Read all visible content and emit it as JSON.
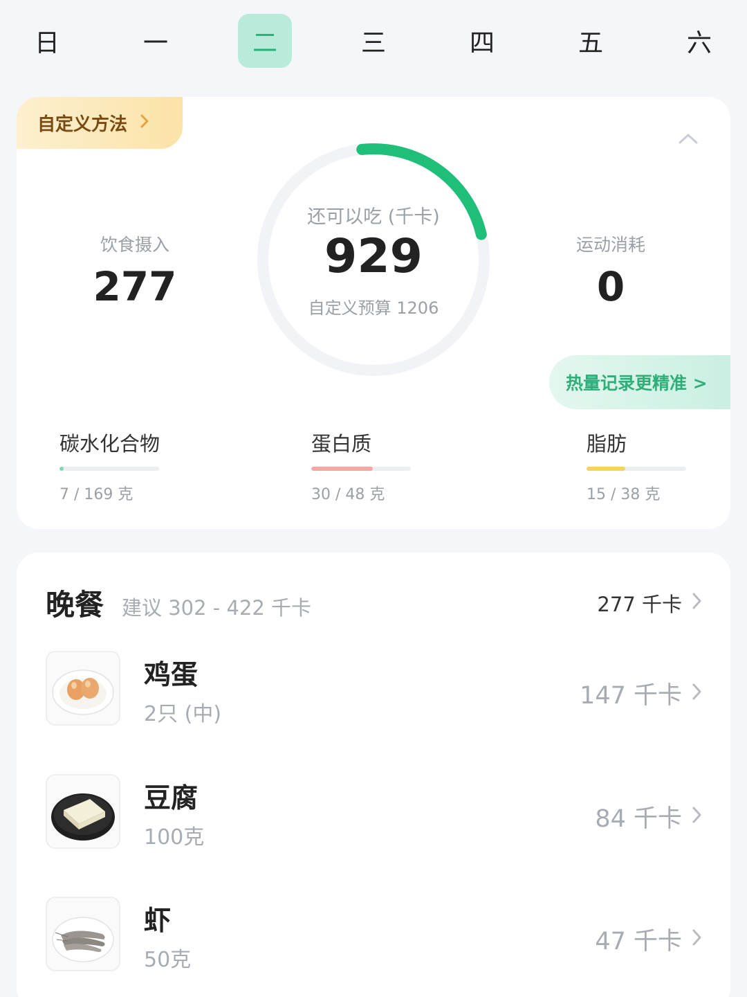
{
  "weekdays": [
    {
      "label": "日",
      "active": false
    },
    {
      "label": "一",
      "active": false
    },
    {
      "label": "二",
      "active": true
    },
    {
      "label": "三",
      "active": false
    },
    {
      "label": "四",
      "active": false
    },
    {
      "label": "五",
      "active": false
    },
    {
      "label": "六",
      "active": false
    }
  ],
  "summary": {
    "custom_method_label": "自定义方法",
    "intake_label": "饮食摄入",
    "intake_value": "277",
    "remaining_label": "还可以吃 (千卡)",
    "remaining_value": "929",
    "budget_label": "自定义预算 1206",
    "remaining_fraction": 0.23,
    "exercise_label": "运动消耗",
    "exercise_value": "0",
    "precise_label": "热量记录更精准 >",
    "accent_color": "#1fbf7a"
  },
  "macros": [
    {
      "name": "碳水化合物",
      "amount": "7 / 169 克",
      "fraction": 0.04,
      "color": "#7fd9b0"
    },
    {
      "name": "蛋白质",
      "amount": "30 / 48 克",
      "fraction": 0.62,
      "color": "#f4a8a4"
    },
    {
      "name": "脂肪",
      "amount": "15 / 38 克",
      "fraction": 0.39,
      "color": "#f6d35a"
    }
  ],
  "meal": {
    "title": "晚餐",
    "suggestion": "建议 302 - 422 千卡",
    "total": "277 千卡",
    "foods": [
      {
        "name": "鸡蛋",
        "qty": "2只 (中)",
        "kcal": "147 千卡",
        "icon": "egg-icon"
      },
      {
        "name": "豆腐",
        "qty": "100克",
        "kcal": "84 千卡",
        "icon": "tofu-icon"
      },
      {
        "name": "虾",
        "qty": "50克",
        "kcal": "47 千卡",
        "icon": "shrimp-icon"
      }
    ]
  }
}
